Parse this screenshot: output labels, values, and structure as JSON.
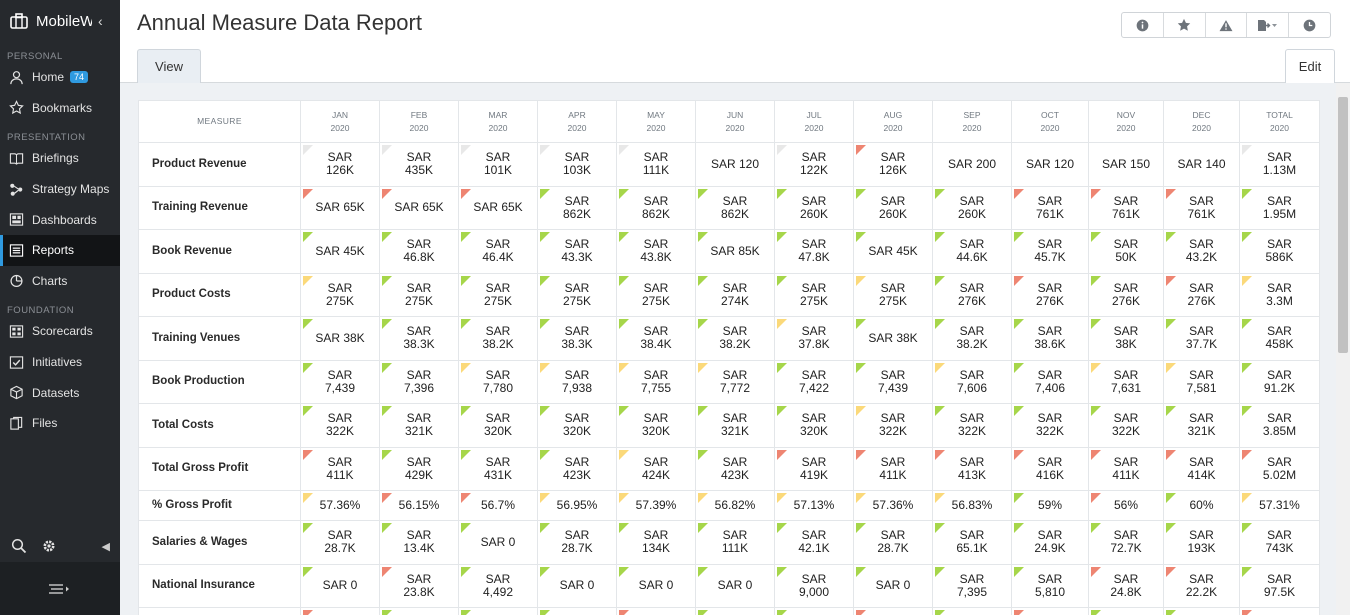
{
  "app": {
    "brand": "MobileW",
    "page_title": "Annual Measure Data Report"
  },
  "sidebar": {
    "sections": {
      "personal": "PERSONAL",
      "presentation": "PRESENTATION",
      "foundation": "FOUNDATION"
    },
    "items": [
      {
        "label": "Home",
        "icon": "user-icon",
        "badge": "74"
      },
      {
        "label": "Bookmarks",
        "icon": "star-icon"
      },
      {
        "label": "Briefings",
        "icon": "book-icon"
      },
      {
        "label": "Strategy Maps",
        "icon": "strategy-map-icon"
      },
      {
        "label": "Dashboards",
        "icon": "dashboard-icon"
      },
      {
        "label": "Reports",
        "icon": "list-icon",
        "active": true
      },
      {
        "label": "Charts",
        "icon": "pie-chart-icon"
      },
      {
        "label": "Scorecards",
        "icon": "grid-icon"
      },
      {
        "label": "Initiatives",
        "icon": "check-square-icon"
      },
      {
        "label": "Datasets",
        "icon": "cube-icon"
      },
      {
        "label": "Files",
        "icon": "files-icon"
      }
    ]
  },
  "tabs": {
    "view": "View",
    "edit": "Edit"
  },
  "toolbar": [
    "info-icon",
    "star-icon",
    "warning-icon",
    "export-icon",
    "history-icon"
  ],
  "colors": {
    "green": "#a6d64a",
    "yellow": "#fbd97a",
    "red": "#ee8572",
    "none": "#e8e8e8",
    "accent": "#2f9ae0"
  },
  "table": {
    "measure_header": "MEASURE",
    "columns": [
      {
        "m": "JAN",
        "y": "2020"
      },
      {
        "m": "FEB",
        "y": "2020"
      },
      {
        "m": "MAR",
        "y": "2020"
      },
      {
        "m": "APR",
        "y": "2020"
      },
      {
        "m": "MAY",
        "y": "2020"
      },
      {
        "m": "JUN",
        "y": "2020"
      },
      {
        "m": "JUL",
        "y": "2020"
      },
      {
        "m": "AUG",
        "y": "2020"
      },
      {
        "m": "SEP",
        "y": "2020"
      },
      {
        "m": "OCT",
        "y": "2020"
      },
      {
        "m": "NOV",
        "y": "2020"
      },
      {
        "m": "DEC",
        "y": "2020"
      },
      {
        "m": "TOTAL",
        "y": "2020"
      }
    ],
    "rows": [
      {
        "name": "Product Revenue",
        "cells": [
          {
            "v": "SAR\n126K",
            "s": "n"
          },
          {
            "v": "SAR\n435K",
            "s": "n"
          },
          {
            "v": "SAR\n101K",
            "s": "n"
          },
          {
            "v": "SAR\n103K",
            "s": "n"
          },
          {
            "v": "SAR\n111K",
            "s": "n"
          },
          {
            "v": "SAR 120",
            "s": ""
          },
          {
            "v": "SAR\n122K",
            "s": "n"
          },
          {
            "v": "SAR\n126K",
            "s": "r"
          },
          {
            "v": "SAR 200",
            "s": ""
          },
          {
            "v": "SAR 120",
            "s": ""
          },
          {
            "v": "SAR 150",
            "s": ""
          },
          {
            "v": "SAR 140",
            "s": ""
          },
          {
            "v": "SAR\n1.13M",
            "s": "n"
          }
        ]
      },
      {
        "name": "Training Revenue",
        "cells": [
          {
            "v": "SAR 65K",
            "s": "r"
          },
          {
            "v": "SAR 65K",
            "s": "r"
          },
          {
            "v": "SAR 65K",
            "s": "r"
          },
          {
            "v": "SAR\n862K",
            "s": "g"
          },
          {
            "v": "SAR\n862K",
            "s": "g"
          },
          {
            "v": "SAR\n862K",
            "s": "g"
          },
          {
            "v": "SAR\n260K",
            "s": "g"
          },
          {
            "v": "SAR\n260K",
            "s": "g"
          },
          {
            "v": "SAR\n260K",
            "s": "g"
          },
          {
            "v": "SAR\n761K",
            "s": "r"
          },
          {
            "v": "SAR\n761K",
            "s": "r"
          },
          {
            "v": "SAR\n761K",
            "s": "r"
          },
          {
            "v": "SAR\n1.95M",
            "s": "g"
          }
        ]
      },
      {
        "name": "Book Revenue",
        "cells": [
          {
            "v": "SAR 45K",
            "s": "g"
          },
          {
            "v": "SAR\n46.8K",
            "s": "g"
          },
          {
            "v": "SAR\n46.4K",
            "s": "g"
          },
          {
            "v": "SAR\n43.3K",
            "s": "g"
          },
          {
            "v": "SAR\n43.8K",
            "s": "g"
          },
          {
            "v": "SAR 85K",
            "s": "g"
          },
          {
            "v": "SAR\n47.8K",
            "s": "g"
          },
          {
            "v": "SAR 45K",
            "s": "g"
          },
          {
            "v": "SAR\n44.6K",
            "s": "g"
          },
          {
            "v": "SAR\n45.7K",
            "s": "g"
          },
          {
            "v": "SAR\n50K",
            "s": "g"
          },
          {
            "v": "SAR\n43.2K",
            "s": "g"
          },
          {
            "v": "SAR\n586K",
            "s": "g"
          }
        ]
      },
      {
        "name": "Product Costs",
        "cells": [
          {
            "v": "SAR\n275K",
            "s": "y"
          },
          {
            "v": "SAR\n275K",
            "s": "g"
          },
          {
            "v": "SAR\n275K",
            "s": "g"
          },
          {
            "v": "SAR\n275K",
            "s": "g"
          },
          {
            "v": "SAR\n275K",
            "s": "g"
          },
          {
            "v": "SAR\n274K",
            "s": "g"
          },
          {
            "v": "SAR\n275K",
            "s": "g"
          },
          {
            "v": "SAR\n275K",
            "s": "y"
          },
          {
            "v": "SAR\n276K",
            "s": "g"
          },
          {
            "v": "SAR\n276K",
            "s": "r"
          },
          {
            "v": "SAR\n276K",
            "s": "g"
          },
          {
            "v": "SAR\n276K",
            "s": "r"
          },
          {
            "v": "SAR\n3.3M",
            "s": "y"
          }
        ]
      },
      {
        "name": "Training Venues",
        "cells": [
          {
            "v": "SAR 38K",
            "s": "g"
          },
          {
            "v": "SAR\n38.3K",
            "s": "g"
          },
          {
            "v": "SAR\n38.2K",
            "s": "g"
          },
          {
            "v": "SAR\n38.3K",
            "s": "g"
          },
          {
            "v": "SAR\n38.4K",
            "s": "g"
          },
          {
            "v": "SAR\n38.2K",
            "s": "g"
          },
          {
            "v": "SAR\n37.8K",
            "s": "y"
          },
          {
            "v": "SAR 38K",
            "s": "g"
          },
          {
            "v": "SAR\n38.2K",
            "s": "g"
          },
          {
            "v": "SAR\n38.6K",
            "s": "g"
          },
          {
            "v": "SAR\n38K",
            "s": "g"
          },
          {
            "v": "SAR\n37.7K",
            "s": "g"
          },
          {
            "v": "SAR\n458K",
            "s": "g"
          }
        ]
      },
      {
        "name": "Book Production",
        "cells": [
          {
            "v": "SAR\n7,439",
            "s": "g"
          },
          {
            "v": "SAR\n7,396",
            "s": "g"
          },
          {
            "v": "SAR\n7,780",
            "s": "y"
          },
          {
            "v": "SAR\n7,938",
            "s": "y"
          },
          {
            "v": "SAR\n7,755",
            "s": "y"
          },
          {
            "v": "SAR\n7,772",
            "s": "y"
          },
          {
            "v": "SAR\n7,422",
            "s": "g"
          },
          {
            "v": "SAR\n7,439",
            "s": "g"
          },
          {
            "v": "SAR\n7,606",
            "s": "y"
          },
          {
            "v": "SAR\n7,406",
            "s": "g"
          },
          {
            "v": "SAR\n7,631",
            "s": "y"
          },
          {
            "v": "SAR\n7,581",
            "s": "y"
          },
          {
            "v": "SAR\n91.2K",
            "s": "g"
          }
        ]
      },
      {
        "name": "Total Costs",
        "cells": [
          {
            "v": "SAR\n322K",
            "s": "g"
          },
          {
            "v": "SAR\n321K",
            "s": "g"
          },
          {
            "v": "SAR\n320K",
            "s": "g"
          },
          {
            "v": "SAR\n320K",
            "s": "g"
          },
          {
            "v": "SAR\n320K",
            "s": "g"
          },
          {
            "v": "SAR\n321K",
            "s": "g"
          },
          {
            "v": "SAR\n320K",
            "s": "g"
          },
          {
            "v": "SAR\n322K",
            "s": "y"
          },
          {
            "v": "SAR\n322K",
            "s": "g"
          },
          {
            "v": "SAR\n322K",
            "s": "g"
          },
          {
            "v": "SAR\n322K",
            "s": "g"
          },
          {
            "v": "SAR\n321K",
            "s": "g"
          },
          {
            "v": "SAR\n3.85M",
            "s": "g"
          }
        ]
      },
      {
        "name": "Total Gross Profit",
        "cells": [
          {
            "v": "SAR\n411K",
            "s": "r"
          },
          {
            "v": "SAR\n429K",
            "s": "g"
          },
          {
            "v": "SAR\n431K",
            "s": "g"
          },
          {
            "v": "SAR\n423K",
            "s": "g"
          },
          {
            "v": "SAR\n424K",
            "s": "y"
          },
          {
            "v": "SAR\n423K",
            "s": "g"
          },
          {
            "v": "SAR\n419K",
            "s": "r"
          },
          {
            "v": "SAR\n411K",
            "s": "r"
          },
          {
            "v": "SAR\n413K",
            "s": "r"
          },
          {
            "v": "SAR\n416K",
            "s": "r"
          },
          {
            "v": "SAR\n411K",
            "s": "r"
          },
          {
            "v": "SAR\n414K",
            "s": "r"
          },
          {
            "v": "SAR\n5.02M",
            "s": "r"
          }
        ]
      },
      {
        "name": "% Gross Profit",
        "short": true,
        "cells": [
          {
            "v": "57.36%",
            "s": "y"
          },
          {
            "v": "56.15%",
            "s": "r"
          },
          {
            "v": "56.7%",
            "s": "r"
          },
          {
            "v": "56.95%",
            "s": "y"
          },
          {
            "v": "57.39%",
            "s": "y"
          },
          {
            "v": "56.82%",
            "s": "y"
          },
          {
            "v": "57.13%",
            "s": "y"
          },
          {
            "v": "57.36%",
            "s": "y"
          },
          {
            "v": "56.83%",
            "s": "y"
          },
          {
            "v": "59%",
            "s": "g"
          },
          {
            "v": "56%",
            "s": "r"
          },
          {
            "v": "60%",
            "s": "g"
          },
          {
            "v": "57.31%",
            "s": "y"
          }
        ]
      },
      {
        "name": "Salaries & Wages",
        "cells": [
          {
            "v": "SAR\n28.7K",
            "s": "g"
          },
          {
            "v": "SAR\n13.4K",
            "s": "g"
          },
          {
            "v": "SAR 0",
            "s": "g"
          },
          {
            "v": "SAR\n28.7K",
            "s": "g"
          },
          {
            "v": "SAR\n134K",
            "s": "g"
          },
          {
            "v": "SAR\n111K",
            "s": "g"
          },
          {
            "v": "SAR\n42.1K",
            "s": "g"
          },
          {
            "v": "SAR\n28.7K",
            "s": "g"
          },
          {
            "v": "SAR\n65.1K",
            "s": "g"
          },
          {
            "v": "SAR\n24.9K",
            "s": "g"
          },
          {
            "v": "SAR\n72.7K",
            "s": "g"
          },
          {
            "v": "SAR\n193K",
            "s": "g"
          },
          {
            "v": "SAR\n743K",
            "s": "g"
          }
        ]
      },
      {
        "name": "National Insurance",
        "cells": [
          {
            "v": "SAR 0",
            "s": "g"
          },
          {
            "v": "SAR\n23.8K",
            "s": "r"
          },
          {
            "v": "SAR\n4,492",
            "s": "g"
          },
          {
            "v": "SAR 0",
            "s": "g"
          },
          {
            "v": "SAR 0",
            "s": "g"
          },
          {
            "v": "SAR 0",
            "s": "g"
          },
          {
            "v": "SAR\n9,000",
            "s": "g"
          },
          {
            "v": "SAR 0",
            "s": "g"
          },
          {
            "v": "SAR\n7,395",
            "s": "g"
          },
          {
            "v": "SAR\n5,810",
            "s": "g"
          },
          {
            "v": "SAR\n24.8K",
            "s": "r"
          },
          {
            "v": "SAR\n22.2K",
            "s": "r"
          },
          {
            "v": "SAR\n97.5K",
            "s": "g"
          }
        ]
      }
    ],
    "partial_row_status": [
      "r",
      "g",
      "g",
      "g",
      "r",
      "g",
      "g",
      "r",
      "g",
      "r",
      "g",
      "g",
      "r"
    ]
  }
}
